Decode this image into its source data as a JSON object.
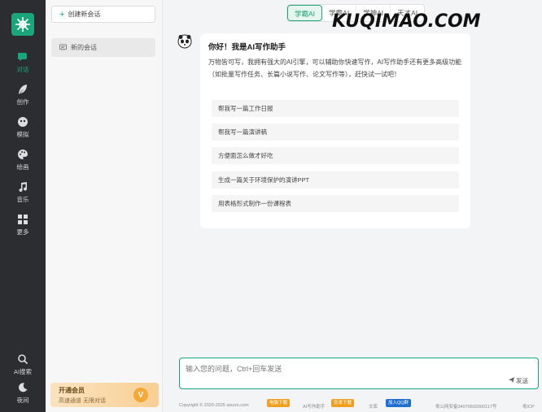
{
  "rail": {
    "items": [
      {
        "label": "对话",
        "icon": "chat-icon",
        "active": true
      },
      {
        "label": "创作",
        "icon": "feather-icon"
      },
      {
        "label": "模拟",
        "icon": "mask-icon"
      },
      {
        "label": "绘画",
        "icon": "palette-icon"
      },
      {
        "label": "音乐",
        "icon": "music-note-icon"
      },
      {
        "label": "更多",
        "icon": "grid-icon"
      }
    ],
    "bottom": [
      {
        "label": "AI搜索",
        "icon": "search-icon"
      },
      {
        "label": "夜间",
        "icon": "moon-icon"
      }
    ]
  },
  "sidebar": {
    "new_chat_label": "创建新会话",
    "conversations": [
      "新的会话"
    ],
    "vip": {
      "title": "开通会员",
      "subtitle": "高速通道 无限对话",
      "badge": "V"
    }
  },
  "tabs": [
    "学霸AI",
    "学霸AI",
    "学神AI",
    "天才AI"
  ],
  "watermark": "KUQIMAO.COM",
  "message": {
    "title": "你好！我是AI写作助手",
    "body": "万物皆可写，我拥有强大的AI引擎，可以辅助你快速写作，AI写作助手还有更多高级功能（如批量写作任务、长篇小说写作、论文写作等），赶快试一试吧！",
    "suggestions": [
      "帮我写一篇工作日报",
      "帮我写一篇演讲稿",
      "方便面怎么做才好吃",
      "生成一篇关于环境保护的演讲PPT",
      "用表格形式制作一份课程表"
    ]
  },
  "input": {
    "placeholder": "输入您的问题，Ctrl+回车发送",
    "send_label": "发送"
  },
  "footer": {
    "copyright": "Copyright © 2020-2025 aixzzs.com",
    "badge_pc": "电脑下载",
    "ai_writer": "AI写作助手",
    "badge_android": "安卓下载",
    "library": "文库",
    "badge_qq": "加入QQ群",
    "police": "粤公网安备34070502000117号",
    "icp": "粤ICP"
  },
  "colors": {
    "accent": "#1aa57a",
    "rail_bg": "#2b2d31"
  }
}
